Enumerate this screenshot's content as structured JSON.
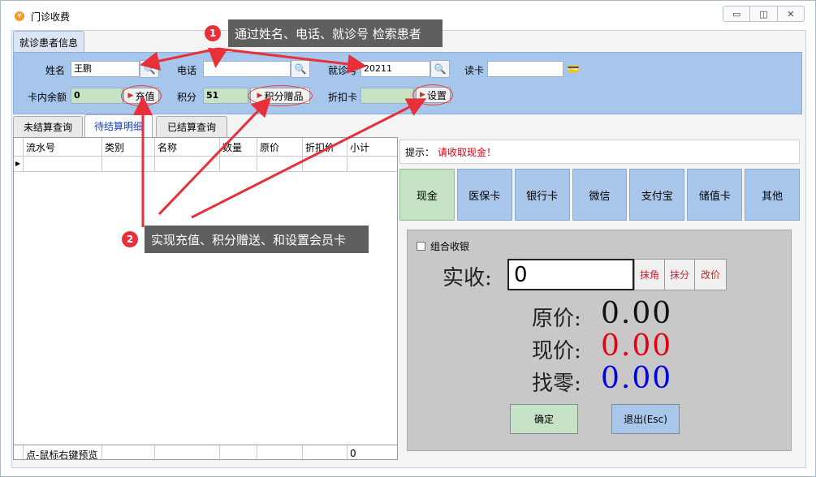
{
  "window": {
    "title": "门诊收费",
    "app_icon": "yen-coin-icon",
    "controls": [
      "minimize",
      "restore",
      "close"
    ]
  },
  "patient": {
    "group_title": "就诊患者信息",
    "name_label": "姓名",
    "name_value": "王鹏",
    "phone_label": "电话",
    "phone_value": "",
    "visit_label": "就诊号",
    "visit_value": "20211",
    "card_label": "读卡",
    "card_value": "",
    "balance_label": "卡内余额",
    "balance_value": "0",
    "recharge_button": "充值",
    "points_label": "积分",
    "points_value": "51",
    "points_gift_button": "积分赠品",
    "discount_label": "折扣卡",
    "discount_value": "",
    "settings_button": "设置"
  },
  "tabs": [
    {
      "label": "未结算查询",
      "active": false
    },
    {
      "label": "待结算明细",
      "active": true
    },
    {
      "label": "已结算查询",
      "active": false
    }
  ],
  "grid": {
    "columns": [
      "流水号",
      "类别",
      "名称",
      "数量",
      "原价",
      "折扣价",
      "小计"
    ],
    "footer_note": "点-鼠标右键预览",
    "footer_total": "0"
  },
  "payment": {
    "hint_label": "提示：",
    "hint_message": "请收取现金！",
    "methods": [
      "现金",
      "医保卡",
      "银行卡",
      "微信",
      "支付宝",
      "储值卡",
      "其他"
    ],
    "active_method": "现金",
    "combo_label": "组合收银",
    "received_label": "实收:",
    "received_value": "0",
    "round_button": "抹角",
    "cents_button": "抹分",
    "edit_price_button": "改价",
    "original_label": "原价:",
    "original_value": "0.00",
    "current_label": "现价:",
    "current_value": "0.00",
    "change_label": "找零:",
    "change_value": "0.00",
    "confirm_button": "确定",
    "exit_button": "退出(Esc)",
    "colors": {
      "original": "#111111",
      "current": "#e60012",
      "change": "#0000e6"
    }
  },
  "callouts": [
    {
      "number": "1",
      "text": "通过姓名、电话、就诊号 检索患者"
    },
    {
      "number": "2",
      "text": "实现充值、积分赠送、和设置会员卡"
    }
  ]
}
